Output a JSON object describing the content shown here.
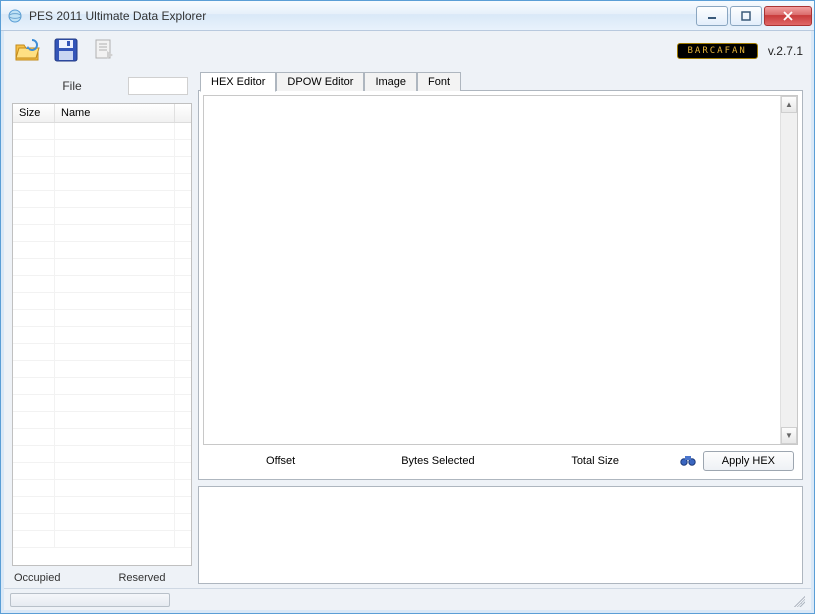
{
  "window": {
    "title": "PES 2011 Ultimate Data Explorer"
  },
  "brand": {
    "label": "BARCAFAN",
    "version": "v.2.7.1"
  },
  "toolbar": {
    "icons": {
      "open": "folder-open-icon",
      "save": "save-icon",
      "export": "document-export-icon"
    }
  },
  "left": {
    "file_label": "File",
    "columns": {
      "size": "Size",
      "name": "Name"
    },
    "footer": {
      "occupied": "Occupied",
      "reserved": "Reserved"
    }
  },
  "tabs": [
    {
      "label": "HEX Editor",
      "active": true
    },
    {
      "label": "DPOW Editor",
      "active": false
    },
    {
      "label": "Image",
      "active": false
    },
    {
      "label": "Font",
      "active": false
    }
  ],
  "hex": {
    "offset_label": "Offset",
    "bytes_label": "Bytes Selected",
    "total_label": "Total Size",
    "apply_label": "Apply HEX"
  }
}
